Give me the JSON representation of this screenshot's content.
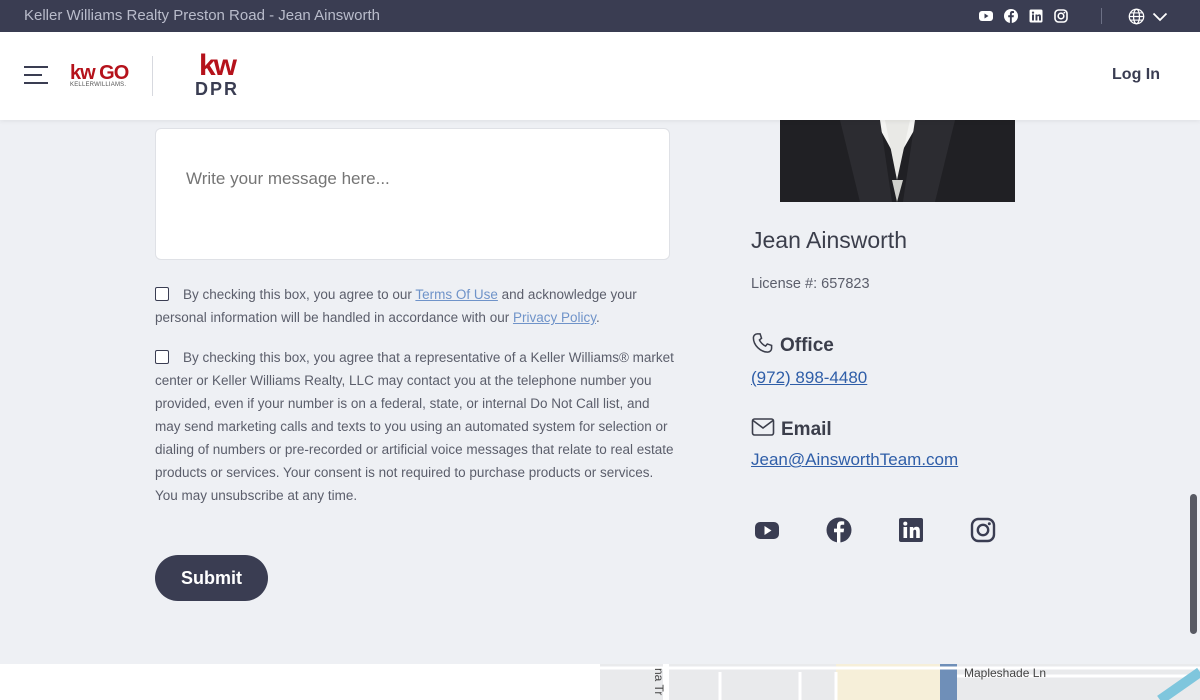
{
  "topbar": {
    "title": "Keller Williams Realty Preston Road - Jean Ainsworth",
    "icons": [
      "youtube-icon",
      "facebook-icon",
      "linkedin-icon",
      "instagram-icon",
      "globe-icon",
      "chevron-down-icon"
    ]
  },
  "header": {
    "logo_kwgo": {
      "kw": "kw",
      "go": "GO",
      "sub": "KELLERWILLIAMS."
    },
    "logo_dpr": {
      "kw": "kw",
      "sub": "DPR"
    },
    "login_label": "Log In"
  },
  "form": {
    "message_placeholder": "Write your message here...",
    "consent_terms": {
      "before": "By checking this box, you agree to our ",
      "terms_link": "Terms Of Use",
      "middle": " and acknowledge your personal information will be handled in accordance with our ",
      "privacy_link": "Privacy Policy",
      "after": "."
    },
    "consent_contact": "By checking this box, you agree that a representative of a Keller Williams® market center or Keller Williams Realty, LLC may contact you at the telephone number you provided, even if your number is on a federal, state, or internal Do Not Call list, and may send marketing calls and texts to you using an automated system for selection or dialing of numbers or pre-recorded or artificial voice messages that relate to real estate products or services. Your consent is not required to purchase products or services. You may unsubscribe at any time.",
    "submit_label": "Submit"
  },
  "agent": {
    "name": "Jean Ainsworth",
    "license": "License #: 657823",
    "office_label": "Office",
    "office_phone": "(972) 898-4480",
    "email_label": "Email",
    "email": "Jean@AinsworthTeam.com",
    "socials": [
      "youtube-icon",
      "facebook-icon",
      "linkedin-icon",
      "instagram-icon"
    ]
  },
  "map": {
    "street_1": "Mapleshade Ln",
    "street_2": "na Tr"
  },
  "colors": {
    "topbar_bg": "#3a3d52",
    "brand_red": "#b5121b",
    "link_blue": "#2f5ea8",
    "page_bg": "#eef0f4"
  }
}
